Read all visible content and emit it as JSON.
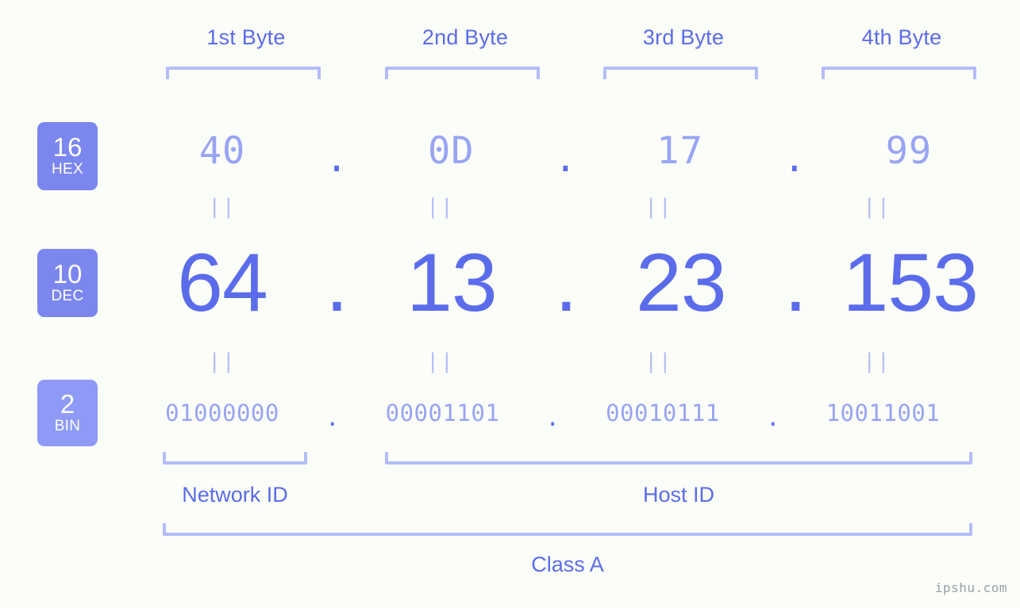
{
  "background": "#fbfdf8",
  "colors": {
    "accent": "#5b6ceb",
    "accent_light": "#98a4f3",
    "bracket": "#b4bdf8",
    "badge_strong": "#7b86ef",
    "badge_soft": "#8e9af5",
    "watermark": "#9aa0a6"
  },
  "byte_headers": [
    {
      "label": "1st Byte"
    },
    {
      "label": "2nd Byte"
    },
    {
      "label": "3rd Byte"
    },
    {
      "label": "4th Byte"
    }
  ],
  "bases": [
    {
      "id": "hex",
      "number": "16",
      "name": "HEX"
    },
    {
      "id": "dec",
      "number": "10",
      "name": "DEC"
    },
    {
      "id": "bin",
      "number": "2",
      "name": "BIN"
    }
  ],
  "separator": ".",
  "equals_mark": "||",
  "rows": {
    "hex": {
      "values": [
        "40",
        "0D",
        "17",
        "99"
      ]
    },
    "dec": {
      "values": [
        "64",
        "13",
        "23",
        "153"
      ]
    },
    "bin": {
      "values": [
        "01000000",
        "00001101",
        "00010111",
        "10011001"
      ]
    }
  },
  "segments": {
    "network_id": "Network ID",
    "host_id": "Host ID"
  },
  "class_label": "Class A",
  "watermark": "ipshu.com"
}
